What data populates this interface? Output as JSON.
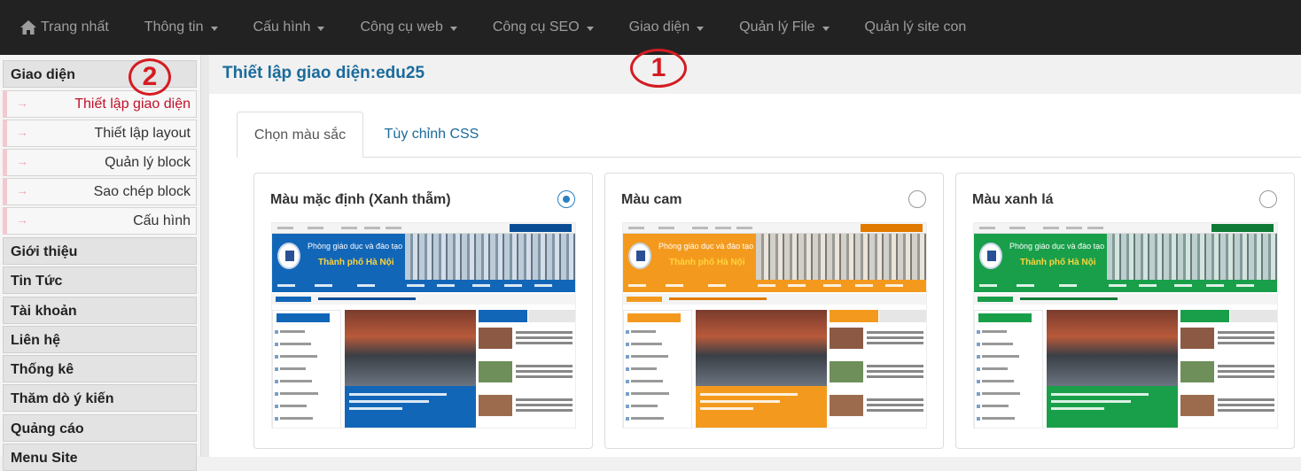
{
  "topnav": {
    "items": [
      {
        "label": "Trang nhất",
        "icon": "home-icon",
        "dropdown": false
      },
      {
        "label": "Thông tin",
        "dropdown": true
      },
      {
        "label": "Cấu hình",
        "dropdown": true
      },
      {
        "label": "Công cụ web",
        "dropdown": true
      },
      {
        "label": "Công cụ SEO",
        "dropdown": true
      },
      {
        "label": "Giao diện",
        "dropdown": true
      },
      {
        "label": "Quản lý File",
        "dropdown": true
      },
      {
        "label": "Quản lý site con",
        "dropdown": false
      }
    ]
  },
  "sidebar": {
    "groups": [
      {
        "label": "Giao diện"
      },
      {
        "label": "Giới thiệu"
      },
      {
        "label": "Tin Tức"
      },
      {
        "label": "Tài khoản"
      },
      {
        "label": "Liên hệ"
      },
      {
        "label": "Thống kê"
      },
      {
        "label": "Thăm dò ý kiến"
      },
      {
        "label": "Quảng cáo"
      },
      {
        "label": "Menu Site"
      }
    ],
    "subitems": [
      {
        "label": "Thiết lập giao diện",
        "active": true
      },
      {
        "label": "Thiết lập layout",
        "active": false
      },
      {
        "label": "Quản lý block",
        "active": false
      },
      {
        "label": "Sao chép block",
        "active": false
      },
      {
        "label": "Cấu hình",
        "active": false
      }
    ]
  },
  "page": {
    "title": "Thiết lập giao diện:edu25"
  },
  "tabs": [
    {
      "label": "Chọn màu sắc",
      "active": true
    },
    {
      "label": "Tùy chỉnh CSS",
      "active": false
    }
  ],
  "themes": [
    {
      "name": "Màu mặc định (Xanh thẫm)",
      "selected": true,
      "color": "#1266b8",
      "accent": "#0b4d94",
      "preview_line1": "Phòng giáo dục và đào tạo",
      "preview_line2": "Thành phố Hà Nội"
    },
    {
      "name": "Màu cam",
      "selected": false,
      "color": "#f39a1e",
      "accent": "#e07a00",
      "preview_line1": "Phòng giáo dục và đào tạo",
      "preview_line2": "Thành phố Hà Nội"
    },
    {
      "name": "Màu xanh lá",
      "selected": false,
      "color": "#199f4a",
      "accent": "#0f7a36",
      "preview_line1": "Phòng giáo dục và đào tạo",
      "preview_line2": "Thành phố Hà Nội"
    }
  ],
  "annotations": [
    {
      "label": "1"
    },
    {
      "label": "2"
    }
  ],
  "colors": {
    "nav_bg": "#222222",
    "title": "#1a6b9c",
    "active_sub": "#c0112a",
    "annotation": "#d41c22"
  }
}
